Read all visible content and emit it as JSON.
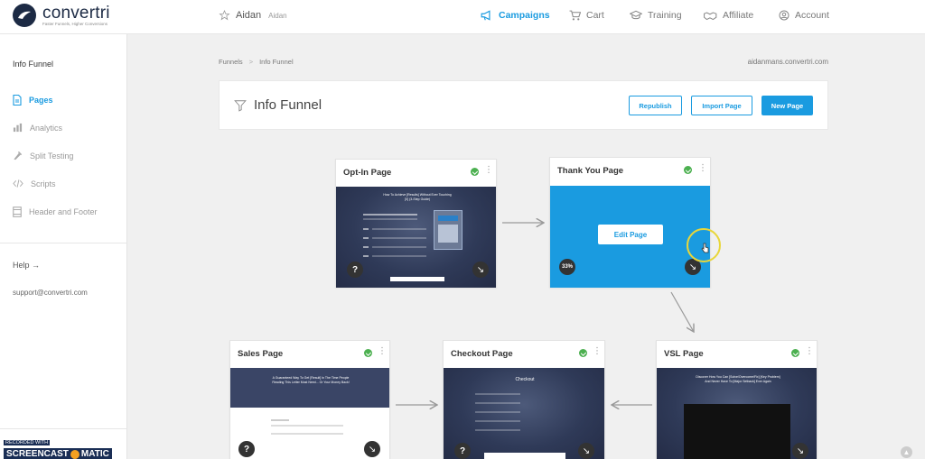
{
  "brand": {
    "name": "convertri",
    "tagline": "Faster Funnels, Higher Conversions"
  },
  "user": {
    "name": "Aidan",
    "sub": "Aidan"
  },
  "nav": [
    {
      "label": "Campaigns",
      "icon": "megaphone-icon",
      "active": true
    },
    {
      "label": "Cart",
      "icon": "cart-icon"
    },
    {
      "label": "Training",
      "icon": "graduation-cap-icon"
    },
    {
      "label": "Affiliate",
      "icon": "handshake-icon"
    },
    {
      "label": "Account",
      "icon": "user-circle-icon"
    }
  ],
  "sidebar": {
    "title": "Info Funnel",
    "items": [
      {
        "label": "Pages",
        "icon": "document-icon",
        "active": true
      },
      {
        "label": "Analytics",
        "icon": "bar-chart-icon"
      },
      {
        "label": "Split Testing",
        "icon": "beaker-icon"
      },
      {
        "label": "Scripts",
        "icon": "code-icon"
      },
      {
        "label": "Header and Footer",
        "icon": "layout-icon"
      }
    ],
    "help": "Help →",
    "support": "support@convertri.com"
  },
  "breadcrumb": {
    "root": "Funnels",
    "separator": ">",
    "current": "Info Funnel"
  },
  "domain": "aidanmans.convertri.com",
  "header": {
    "title": "Info Funnel",
    "buttons": {
      "republish": "Republish",
      "import": "Import Page",
      "new": "New Page"
    }
  },
  "pages": {
    "optin": {
      "title": "Opt-In Page",
      "q": "?",
      "headline": "How To Achieve [Results] Without Ever Touching [X] (3-Step Guide)"
    },
    "thankyou": {
      "title": "Thank You Page",
      "edit": "Edit Page",
      "percent": "33%"
    },
    "sales": {
      "title": "Sales Page",
      "q": "?",
      "headline": "A Guaranteed Way To Get [Result] In The Time People Reading This Letter Most Need... Or Your Money Back!"
    },
    "checkout": {
      "title": "Checkout Page",
      "q": "?",
      "headline": "Checkout"
    },
    "vsl": {
      "title": "VSL Page",
      "headline": "Discover How You Can [Solve/Overcome/Fix] [Key Problem] And Never Have To [Major Setback] Ever Again"
    }
  },
  "watermark": {
    "top": "RECORDED WITH",
    "left": "SCREENCAST",
    "right": "MATIC"
  },
  "colors": {
    "accent": "#1a9be0",
    "success": "#4cb050",
    "dark": "#1c2a44"
  }
}
